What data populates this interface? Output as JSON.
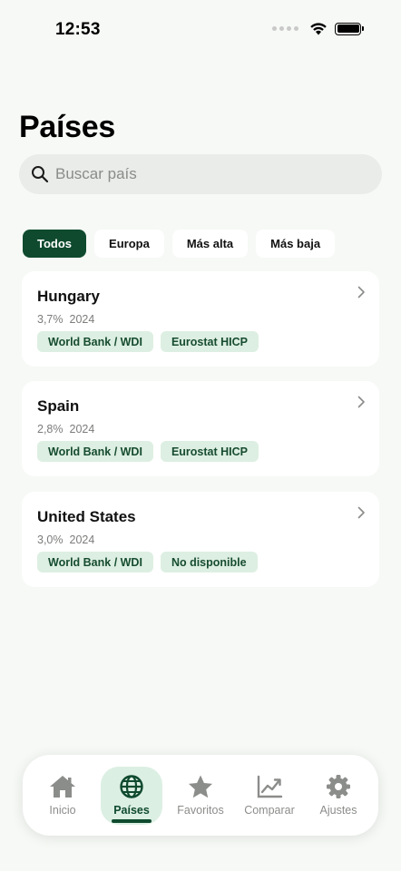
{
  "status_bar": {
    "time": "12:53"
  },
  "page": {
    "title": "Países"
  },
  "search": {
    "placeholder": "Buscar país"
  },
  "filters": [
    {
      "label": "Todos",
      "active": true
    },
    {
      "label": "Europa",
      "active": false
    },
    {
      "label": "Más alta",
      "active": false
    },
    {
      "label": "Más baja",
      "active": false
    }
  ],
  "countries": [
    {
      "name": "Hungary",
      "rate": "3,7%",
      "year": "2024",
      "sources": [
        "World Bank / WDI",
        "Eurostat HICP"
      ]
    },
    {
      "name": "Spain",
      "rate": "2,8%",
      "year": "2024",
      "sources": [
        "World Bank / WDI",
        "Eurostat HICP"
      ]
    },
    {
      "name": "United States",
      "rate": "3,0%",
      "year": "2024",
      "sources": [
        "World Bank / WDI",
        "No disponible"
      ]
    }
  ],
  "tab_bar": {
    "items": [
      {
        "label": "Inicio",
        "icon": "house-icon",
        "active": false
      },
      {
        "label": "Países",
        "icon": "globe-icon",
        "active": true
      },
      {
        "label": "Favoritos",
        "icon": "star-icon",
        "active": false
      },
      {
        "label": "Comparar",
        "icon": "chart-line-icon",
        "active": false
      },
      {
        "label": "Ajustes",
        "icon": "gear-icon",
        "active": false
      }
    ]
  },
  "colors": {
    "accent": "#0f4a2e",
    "tag_background": "#ddefe2",
    "background": "#f6f9f5"
  }
}
